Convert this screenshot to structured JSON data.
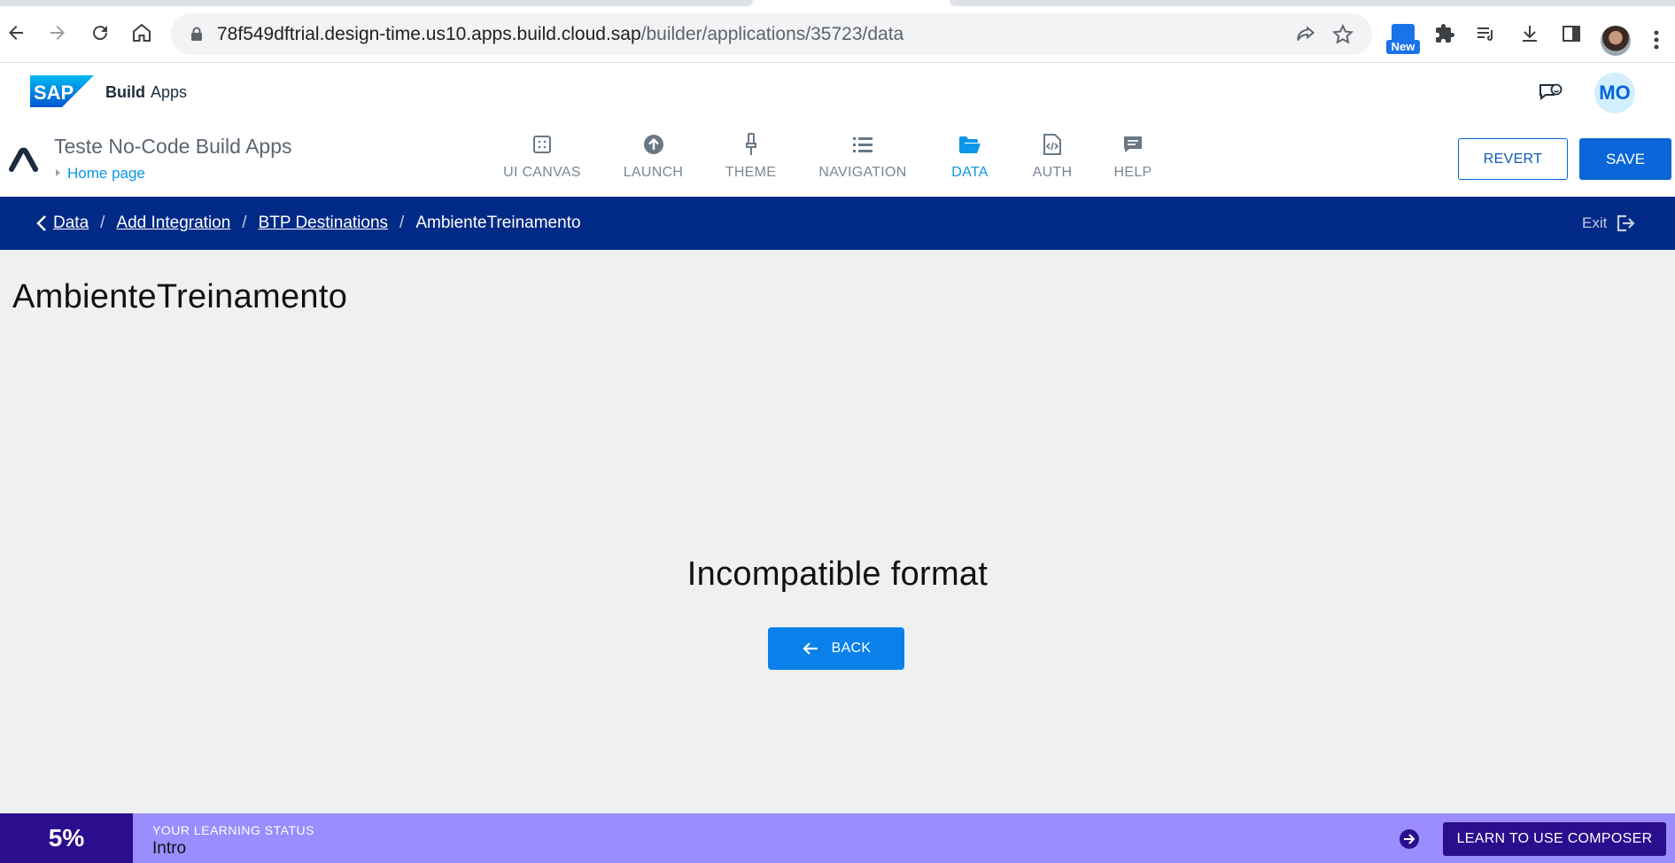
{
  "browser": {
    "url_host": "78f549dftrial.design-time.us10.apps.build.cloud.sap",
    "url_path": "/builder/applications/35723/data",
    "extension_badge": "New",
    "icons": [
      "back-arrow-icon",
      "forward-arrow-icon",
      "reload-icon",
      "home-icon",
      "lock-icon",
      "share-icon",
      "star-icon",
      "puzzle-icon",
      "media-icon",
      "download-icon",
      "side-panel-icon",
      "kebab-icon"
    ]
  },
  "shell": {
    "brand": "SAP",
    "product_bold": "Build",
    "product_name": "Apps",
    "user_initials": "MO",
    "feedback_icon": "feedback-icon"
  },
  "composer": {
    "app_name": "Teste No-Code Build Apps",
    "current_page": "Home page",
    "nav": [
      {
        "label": "UI CANVAS",
        "icon": "canvas-icon",
        "active": false
      },
      {
        "label": "LAUNCH",
        "icon": "upload-icon",
        "active": false
      },
      {
        "label": "THEME",
        "icon": "brush-icon",
        "active": false
      },
      {
        "label": "NAVIGATION",
        "icon": "list-icon",
        "active": false
      },
      {
        "label": "DATA",
        "icon": "folder-open-icon",
        "active": true
      },
      {
        "label": "AUTH",
        "icon": "code-file-icon",
        "active": false
      },
      {
        "label": "HELP",
        "icon": "chat-icon",
        "active": false
      }
    ],
    "revert_label": "REVERT",
    "save_label": "SAVE",
    "colors": {
      "active": "#0a97e8",
      "primary": "#0a66d8",
      "breadcrumb_bg": "#002a86"
    }
  },
  "breadcrumb": {
    "items": [
      "Data",
      "Add Integration",
      "BTP Destinations"
    ],
    "current": "AmbienteTreinamento",
    "separator": "/",
    "exit_label": "Exit"
  },
  "main": {
    "title": "AmbienteTreinamento",
    "message": "Incompatible format",
    "back_label": "BACK"
  },
  "learning": {
    "percent": "5%",
    "caption": "YOUR LEARNING STATUS",
    "level": "Intro",
    "cta_label": "LEARN TO USE COMPOSER",
    "colors": {
      "bar": "#9b8cff",
      "dark": "#2a0e8e"
    }
  }
}
